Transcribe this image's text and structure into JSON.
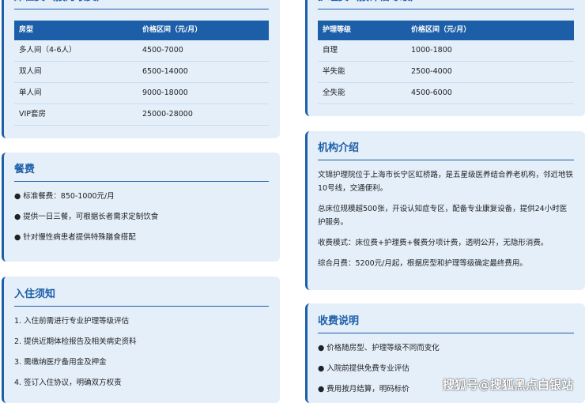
{
  "bed_fee": {
    "title": "床位费（按月收费）",
    "headers": [
      "房型",
      "价格区间（元/月）"
    ],
    "rows": [
      [
        "多人间（4-6人）",
        "4500-7000"
      ],
      [
        "双人间",
        "6500-14000"
      ],
      [
        "单人间",
        "9000-18000"
      ],
      [
        "VIP套房",
        "25000-28000"
      ]
    ]
  },
  "care_fee": {
    "title": "护理费（按评估等级）",
    "headers": [
      "护理等级",
      "价格区间（元/月）"
    ],
    "rows": [
      [
        "自理",
        "1000-1800"
      ],
      [
        "半失能",
        "2500-4000"
      ],
      [
        "全失能",
        "4500-6000"
      ]
    ]
  },
  "meal": {
    "title": "餐费",
    "items": [
      "● 标准餐费：850-1000元/月",
      "● 提供一日三餐，可根据长者需求定制饮食",
      "● 针对慢性病患者提供特殊膳食搭配"
    ]
  },
  "intro": {
    "title": "机构介绍",
    "paragraphs": [
      "文锦护理院位于上海市长宁区虹桥路，是五星级医养结合养老机构，邻近地铁10号线，交通便利。",
      "总床位规模超500张，开设认知症专区，配备专业康复设备，提供24小时医护服务。",
      "收费模式：床位费+护理费+餐费分项计费，透明公开，无隐形消费。",
      "综合月费：5200元/月起，根据房型和护理等级确定最终费用。"
    ]
  },
  "admission": {
    "title": "入住须知",
    "items": [
      "1. 入住前需进行专业护理等级评估",
      "2. 提供近期体检报告及相关病史资料",
      "3. 需缴纳医疗备用金及押金",
      "4. 签订入住协议，明确双方权责"
    ]
  },
  "fee_notes": {
    "title": "收费说明",
    "items": [
      "● 价格随房型、护理等级不同而变化",
      "● 入院前提供免费专业评估",
      "● 费用按月结算，明码标价"
    ]
  },
  "watermark": "搜狐号@搜狐黑点白银站",
  "colors": {
    "accent": "#1c5fa8",
    "card_bg": "#e4effa"
  }
}
